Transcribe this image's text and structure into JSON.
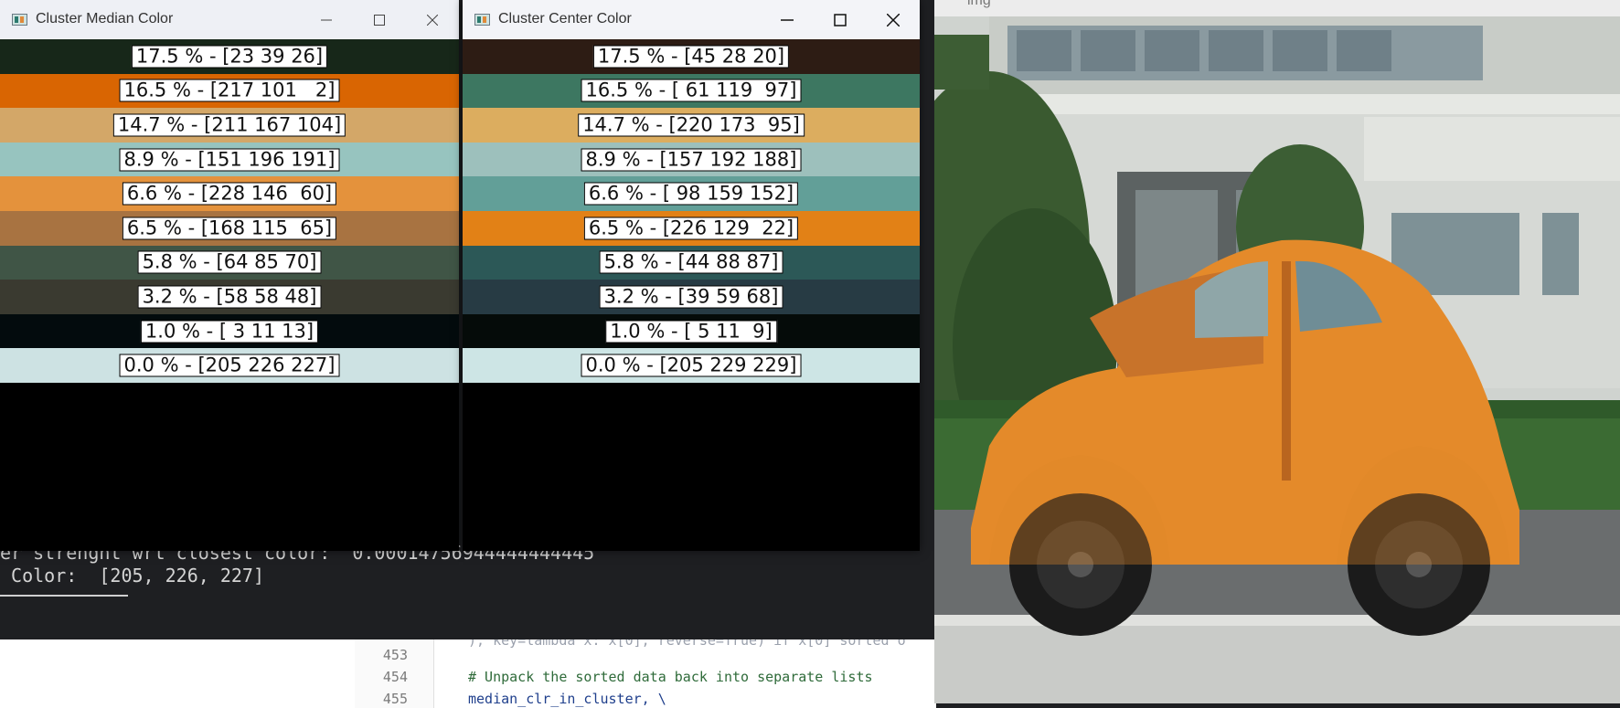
{
  "terminal": {
    "line1": "er strenght wrt closest color:  0.00014756944444444445",
    "line2": " Color:  [205, 226, 227]"
  },
  "editor": {
    "lines": [
      {
        "num": "453",
        "text": ""
      },
      {
        "num": "454",
        "text": "# Unpack the sorted data back into separate lists"
      },
      {
        "num": "455",
        "text": "median_clr_in_cluster, \\"
      }
    ],
    "partial_line": "), key=lambda x: x[0], reverse=True) if x[0] sorted o"
  },
  "median_window": {
    "title": "Cluster Median Color",
    "bars": [
      {
        "label": "17.5 % - [23 39 26]",
        "color": "#172719"
      },
      {
        "label": "16.5 % - [217 101   2]",
        "color": "#d96502"
      },
      {
        "label": "14.7 % - [211 167 104]",
        "color": "#d3a768"
      },
      {
        "label": "8.9 % - [151 196 191]",
        "color": "#97c4bf"
      },
      {
        "label": "6.6 % - [228 146  60]",
        "color": "#e4923c"
      },
      {
        "label": "6.5 % - [168 115  65]",
        "color": "#a87341"
      },
      {
        "label": "5.8 % - [64 85 70]",
        "color": "#405546"
      },
      {
        "label": "3.2 % - [58 58 48]",
        "color": "#3a3a30"
      },
      {
        "label": "1.0 % - [ 3 11 13]",
        "color": "#030b0d"
      },
      {
        "label": "0.0 % - [205 226 227]",
        "color": "#cde2e3"
      }
    ]
  },
  "center_window": {
    "title": "Cluster Center Color",
    "bars": [
      {
        "label": "17.5 % - [45 28 20]",
        "color": "#2d1c14"
      },
      {
        "label": "16.5 % - [ 61 119  97]",
        "color": "#3d7761"
      },
      {
        "label": "14.7 % - [220 173  95]",
        "color": "#dcad5f"
      },
      {
        "label": "8.9 % - [157 192 188]",
        "color": "#9dc0bc"
      },
      {
        "label": "6.6 % - [ 98 159 152]",
        "color": "#629f98"
      },
      {
        "label": "6.5 % - [226 129  22]",
        "color": "#e28116"
      },
      {
        "label": "5.8 % - [44 88 87]",
        "color": "#2c5857"
      },
      {
        "label": "3.2 % - [39 59 68]",
        "color": "#273b44"
      },
      {
        "label": "1.0 % - [ 5 11  9]",
        "color": "#050b09"
      },
      {
        "label": "0.0 % - [205 229 229]",
        "color": "#cde5e5"
      }
    ]
  },
  "img_window": {
    "title": "img"
  }
}
